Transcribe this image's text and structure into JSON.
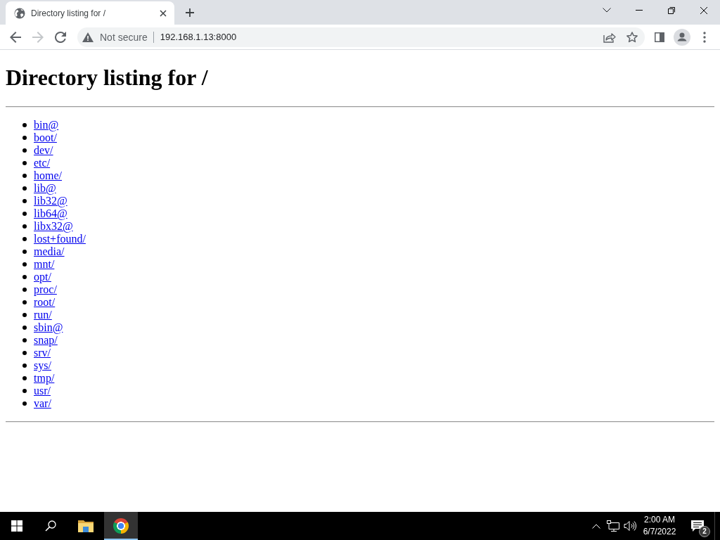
{
  "browser": {
    "tabs": [
      {
        "title": "Directory listing for /",
        "selected": true
      }
    ]
  },
  "toolbar": {
    "nav_buttons": [
      {
        "kind": "back",
        "disabled": false
      },
      {
        "kind": "forward",
        "disabled": true
      },
      {
        "kind": "reload",
        "disabled": false
      }
    ],
    "address_bar": {
      "security_label": "Not secure",
      "url": "192.168.1.13:8000"
    }
  },
  "page": {
    "heading": "Directory listing for /",
    "entries": [
      "bin@",
      "boot/",
      "dev/",
      "etc/",
      "home/",
      "lib@",
      "lib32@",
      "lib64@",
      "libx32@",
      "lost+found/",
      "media/",
      "mnt/",
      "opt/",
      "proc/",
      "root/",
      "run/",
      "sbin@",
      "snap/",
      "srv/",
      "sys/",
      "tmp/",
      "usr/",
      "var/"
    ]
  },
  "taskbar": {
    "apps": [
      {
        "kind": "folder",
        "selected": false
      },
      {
        "kind": "browser",
        "selected": true
      }
    ],
    "clock": {
      "time": "2:00 AM",
      "date": "6/7/2022"
    },
    "notification_count": "2"
  }
}
